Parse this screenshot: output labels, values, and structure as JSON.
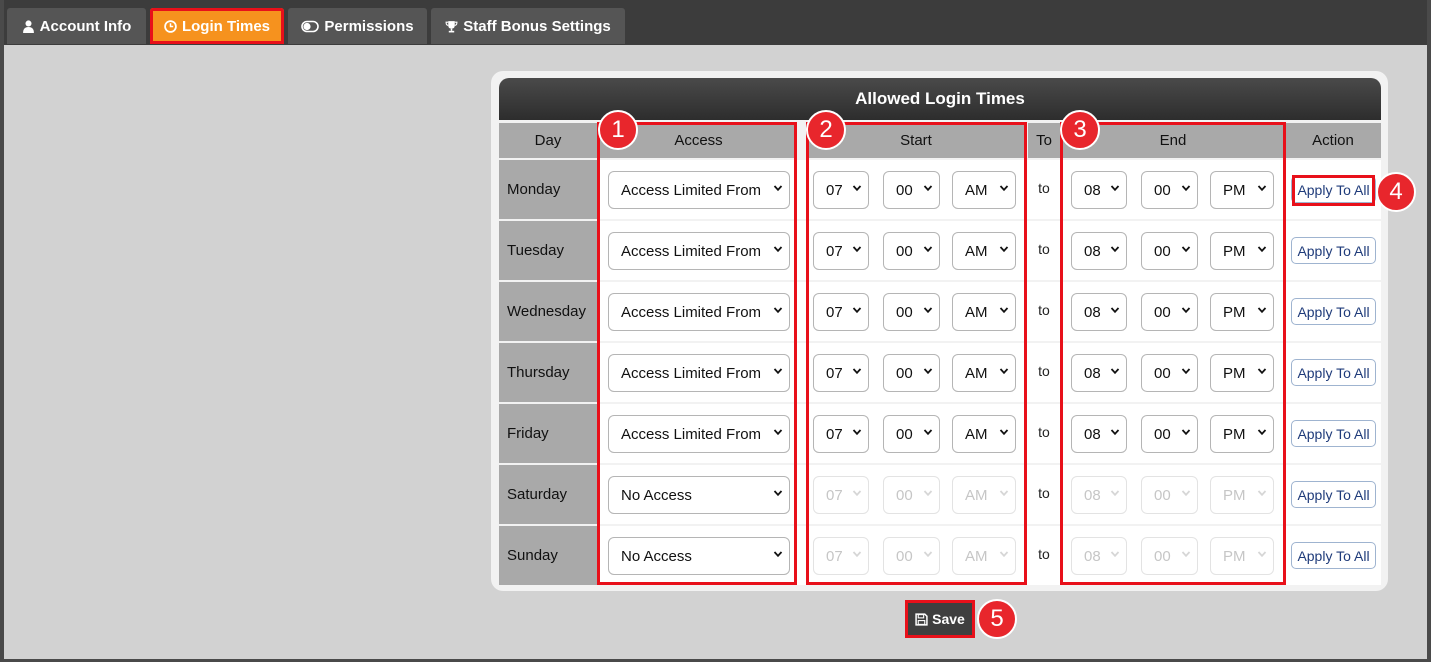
{
  "tabs": [
    {
      "label": "Account Info",
      "icon": "user-icon"
    },
    {
      "label": "Login Times",
      "icon": "clock-icon",
      "active": true
    },
    {
      "label": "Permissions",
      "icon": "toggle-icon"
    },
    {
      "label": "Staff Bonus Settings",
      "icon": "trophy-icon"
    }
  ],
  "panel": {
    "title": "Allowed Login Times",
    "headers": {
      "day": "Day",
      "access": "Access",
      "start": "Start",
      "to": "To",
      "end": "End",
      "action": "Action"
    },
    "rows": [
      {
        "day": "Monday",
        "access": "Access Limited From",
        "start_h": "07",
        "start_m": "00",
        "start_ap": "AM",
        "to": "to",
        "end_h": "08",
        "end_m": "00",
        "end_ap": "PM",
        "action": "Apply To All",
        "disabled": false
      },
      {
        "day": "Tuesday",
        "access": "Access Limited From",
        "start_h": "07",
        "start_m": "00",
        "start_ap": "AM",
        "to": "to",
        "end_h": "08",
        "end_m": "00",
        "end_ap": "PM",
        "action": "Apply To All",
        "disabled": false
      },
      {
        "day": "Wednesday",
        "access": "Access Limited From",
        "start_h": "07",
        "start_m": "00",
        "start_ap": "AM",
        "to": "to",
        "end_h": "08",
        "end_m": "00",
        "end_ap": "PM",
        "action": "Apply To All",
        "disabled": false
      },
      {
        "day": "Thursday",
        "access": "Access Limited From",
        "start_h": "07",
        "start_m": "00",
        "start_ap": "AM",
        "to": "to",
        "end_h": "08",
        "end_m": "00",
        "end_ap": "PM",
        "action": "Apply To All",
        "disabled": false
      },
      {
        "day": "Friday",
        "access": "Access Limited From",
        "start_h": "07",
        "start_m": "00",
        "start_ap": "AM",
        "to": "to",
        "end_h": "08",
        "end_m": "00",
        "end_ap": "PM",
        "action": "Apply To All",
        "disabled": false
      },
      {
        "day": "Saturday",
        "access": "No Access",
        "start_h": "07",
        "start_m": "00",
        "start_ap": "AM",
        "to": "to",
        "end_h": "08",
        "end_m": "00",
        "end_ap": "PM",
        "action": "Apply To All",
        "disabled": true
      },
      {
        "day": "Sunday",
        "access": "No Access",
        "start_h": "07",
        "start_m": "00",
        "start_ap": "AM",
        "to": "to",
        "end_h": "08",
        "end_m": "00",
        "end_ap": "PM",
        "action": "Apply To All",
        "disabled": true
      }
    ]
  },
  "callouts": [
    "1",
    "2",
    "3",
    "4",
    "5"
  ],
  "save_label": "Save",
  "colors": {
    "active_tab": "#f6921e",
    "highlight": "#e8101a",
    "badge": "#e8262c",
    "header_bg": "#a9a9a9"
  }
}
